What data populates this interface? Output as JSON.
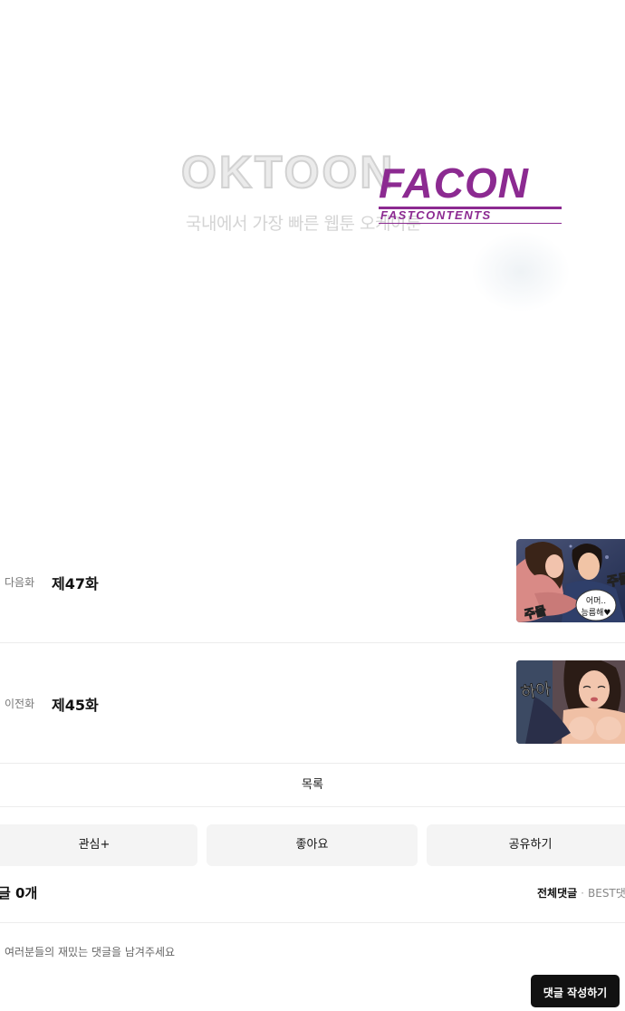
{
  "banner": {
    "oktoon_logo": "OKTOON",
    "oktoon_tagline": "국내에서 가장 빠른 웹툰 오케이툰",
    "facon_logo": "FACON",
    "facon_tagline": "FASTCONTENTS"
  },
  "episodes": {
    "next": {
      "kind": "다음화",
      "title": "제47화",
      "thumb_bubble": "어머..\n능름해♥",
      "thumb_sfx_left": "주물",
      "thumb_sfx_right": "주물"
    },
    "prev": {
      "kind": "이전화",
      "title": "제45화",
      "thumb_sfx": "하아"
    }
  },
  "list_label": "목록",
  "actions": {
    "favorite_label": "관심+",
    "like_label": "좋아요",
    "share_label": "공유하기"
  },
  "comments": {
    "count_label": "글 0개",
    "tab_all": "전체댓글",
    "tab_best": "BEST댓",
    "placeholder": "여러분들의 재밌는 댓글을 남겨주세요",
    "write_label": "댓글 작성하기"
  },
  "colors": {
    "facon_purple": "#8c2a91",
    "button_bg": "#f4f4f4",
    "write_button_bg": "#111111"
  }
}
